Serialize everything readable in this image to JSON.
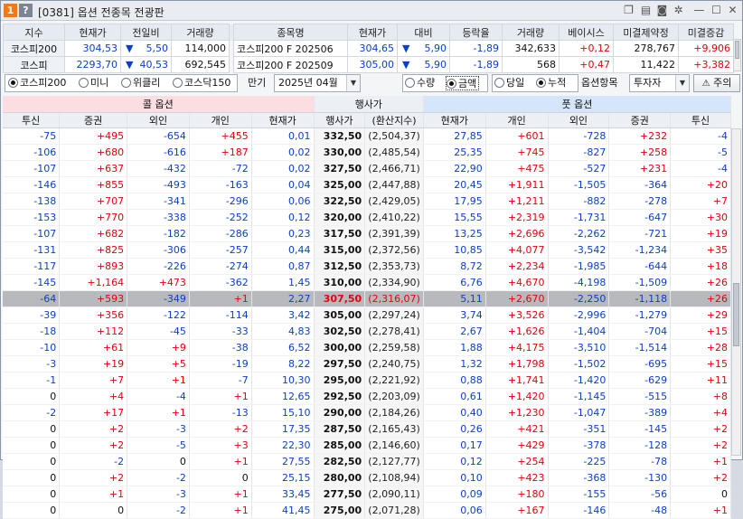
{
  "titlebar": {
    "badge1": "1",
    "badge2": "?",
    "title": "[0381] 옵션 전종목 전광판"
  },
  "summary": {
    "headers_left": [
      "지수",
      "현재가",
      "전일비",
      "거래량"
    ],
    "headers_right": [
      "종목명",
      "현재가",
      "대비",
      "등락율",
      "거래량",
      "베이시스",
      "미결제약정",
      "미결증감"
    ],
    "rows": [
      {
        "index": "코스피200",
        "price": "304,53",
        "dir": "▼",
        "change": "5,50",
        "volume": "114,000",
        "name": "코스피200 F 202506",
        "fprice": "304,65",
        "fdir": "▼",
        "fchange": "5,90",
        "rate": "-1,89",
        "fvolume": "342,633",
        "basis": "+0,12",
        "oi": "278,767",
        "oichg": "+9,906"
      },
      {
        "index": "코스피",
        "price": "2293,70",
        "dir": "▼",
        "change": "40,53",
        "volume": "692,545",
        "name": "코스피200 F 202509",
        "fprice": "305,00",
        "fdir": "▼",
        "fchange": "5,90",
        "rate": "-1,89",
        "fvolume": "568",
        "basis": "+0,47",
        "oi": "11,422",
        "oichg": "+3,382"
      }
    ]
  },
  "controls": {
    "market_radios": [
      "코스피200",
      "미니",
      "위클리",
      "코스닥150"
    ],
    "market_selected": 0,
    "expiry_label": "만기",
    "expiry_value": "2025년 04월",
    "qty_radios": [
      "수량",
      "금액"
    ],
    "qty_selected": 1,
    "period_radios": [
      "당일",
      "누적"
    ],
    "period_selected": 1,
    "item_label": "옵션항목",
    "item_value": "투자자",
    "warn_button": "주의"
  },
  "grid": {
    "call_label": "콜 옵션",
    "strike_label": "행사가",
    "put_label": "풋 옵션",
    "call_cols": [
      "투신",
      "증권",
      "외인",
      "개인",
      "현재가"
    ],
    "mid_cols": [
      "행사가",
      "(환산지수)"
    ],
    "put_cols": [
      "현재가",
      "개인",
      "외인",
      "증권",
      "투신"
    ],
    "highlight_row": 10,
    "rows": [
      [
        "-75",
        "+495",
        "-654",
        "+455",
        "0,01",
        "332,50",
        "(2,504,37)",
        "27,85",
        "+601",
        "-728",
        "+232",
        "-4"
      ],
      [
        "-106",
        "+680",
        "-616",
        "+187",
        "0,02",
        "330,00",
        "(2,485,54)",
        "25,35",
        "+745",
        "-827",
        "+258",
        "-5"
      ],
      [
        "-107",
        "+637",
        "-432",
        "-72",
        "0,02",
        "327,50",
        "(2,466,71)",
        "22,90",
        "+475",
        "-527",
        "+231",
        "-4"
      ],
      [
        "-146",
        "+855",
        "-493",
        "-163",
        "0,04",
        "325,00",
        "(2,447,88)",
        "20,45",
        "+1,911",
        "-1,505",
        "-364",
        "+20"
      ],
      [
        "-138",
        "+707",
        "-341",
        "-296",
        "0,06",
        "322,50",
        "(2,429,05)",
        "17,95",
        "+1,211",
        "-882",
        "-278",
        "+7"
      ],
      [
        "-153",
        "+770",
        "-338",
        "-252",
        "0,12",
        "320,00",
        "(2,410,22)",
        "15,55",
        "+2,319",
        "-1,731",
        "-647",
        "+30"
      ],
      [
        "-107",
        "+682",
        "-182",
        "-286",
        "0,23",
        "317,50",
        "(2,391,39)",
        "13,25",
        "+2,696",
        "-2,262",
        "-721",
        "+19"
      ],
      [
        "-131",
        "+825",
        "-306",
        "-257",
        "0,44",
        "315,00",
        "(2,372,56)",
        "10,85",
        "+4,077",
        "-3,542",
        "-1,234",
        "+35"
      ],
      [
        "-117",
        "+893",
        "-226",
        "-274",
        "0,87",
        "312,50",
        "(2,353,73)",
        "8,72",
        "+2,234",
        "-1,985",
        "-644",
        "+18"
      ],
      [
        "-145",
        "+1,164",
        "+473",
        "-362",
        "1,45",
        "310,00",
        "(2,334,90)",
        "6,76",
        "+4,670",
        "-4,198",
        "-1,509",
        "+26"
      ],
      [
        "-64",
        "+593",
        "-349",
        "+1",
        "2,27",
        "307,50",
        "(2,316,07)",
        "5,11",
        "+2,670",
        "-2,250",
        "-1,118",
        "+26"
      ],
      [
        "-39",
        "+356",
        "-122",
        "-114",
        "3,42",
        "305,00",
        "(2,297,24)",
        "3,74",
        "+3,526",
        "-2,996",
        "-1,279",
        "+29"
      ],
      [
        "-18",
        "+112",
        "-45",
        "-33",
        "4,83",
        "302,50",
        "(2,278,41)",
        "2,67",
        "+1,626",
        "-1,404",
        "-704",
        "+15"
      ],
      [
        "-10",
        "+61",
        "+9",
        "-38",
        "6,52",
        "300,00",
        "(2,259,58)",
        "1,88",
        "+4,175",
        "-3,510",
        "-1,514",
        "+28"
      ],
      [
        "-3",
        "+19",
        "+5",
        "-19",
        "8,22",
        "297,50",
        "(2,240,75)",
        "1,32",
        "+1,798",
        "-1,502",
        "-695",
        "+15"
      ],
      [
        "-1",
        "+7",
        "+1",
        "-7",
        "10,30",
        "295,00",
        "(2,221,92)",
        "0,88",
        "+1,741",
        "-1,420",
        "-629",
        "+11"
      ],
      [
        "0",
        "+4",
        "-4",
        "+1",
        "12,65",
        "292,50",
        "(2,203,09)",
        "0,61",
        "+1,420",
        "-1,145",
        "-515",
        "+8"
      ],
      [
        "-2",
        "+17",
        "+1",
        "-13",
        "15,10",
        "290,00",
        "(2,184,26)",
        "0,40",
        "+1,230",
        "-1,047",
        "-389",
        "+4"
      ],
      [
        "0",
        "+2",
        "-3",
        "+2",
        "17,35",
        "287,50",
        "(2,165,43)",
        "0,26",
        "+421",
        "-351",
        "-145",
        "+2"
      ],
      [
        "0",
        "+2",
        "-5",
        "+3",
        "22,30",
        "285,00",
        "(2,146,60)",
        "0,17",
        "+429",
        "-378",
        "-128",
        "+2"
      ],
      [
        "0",
        "-2",
        "0",
        "+1",
        "27,55",
        "282,50",
        "(2,127,77)",
        "0,12",
        "+254",
        "-225",
        "-78",
        "+1"
      ],
      [
        "0",
        "+2",
        "-2",
        "0",
        "25,15",
        "280,00",
        "(2,108,94)",
        "0,10",
        "+423",
        "-368",
        "-130",
        "+2"
      ],
      [
        "0",
        "+1",
        "-3",
        "+1",
        "33,45",
        "277,50",
        "(2,090,11)",
        "0,09",
        "+180",
        "-155",
        "-56",
        "0"
      ],
      [
        "0",
        "0",
        "-2",
        "+1",
        "41,45",
        "275,00",
        "(2,071,28)",
        "0,06",
        "+167",
        "-146",
        "-48",
        "+1"
      ]
    ]
  }
}
